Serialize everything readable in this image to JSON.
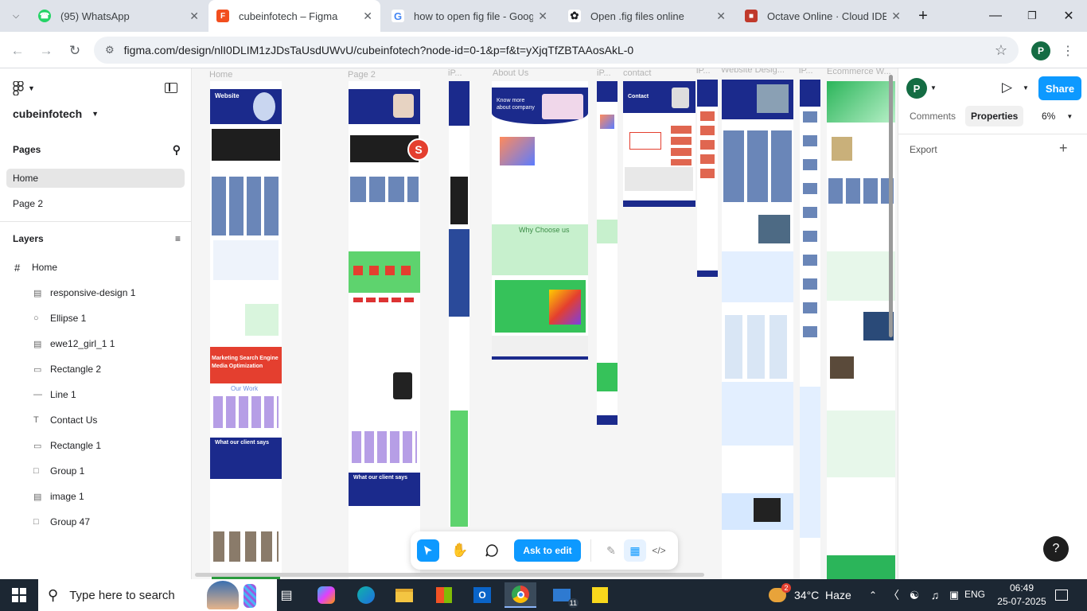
{
  "browser": {
    "tabs": [
      {
        "title": "(95) WhatsApp",
        "icon": "whatsapp-icon",
        "color": "#25d366"
      },
      {
        "title": "cubeinfotech – Figma",
        "icon": "figma-icon",
        "color": "#f24e1e"
      },
      {
        "title": "how to open fig file - Google",
        "icon": "google-icon",
        "color": "#4285f4"
      },
      {
        "title": "Open .fig files online",
        "icon": "openai-icon",
        "color": "#202124"
      },
      {
        "title": "Octave Online · Cloud IDE co",
        "icon": "octave-icon",
        "color": "#c0392b"
      }
    ],
    "url": "figma.com/design/nlI0DLIM1zJDsTaUsdUWvU/cubeinfotech?node-id=0-1&p=f&t=yXjqTfZBTAAosAkL-0",
    "profile_initial": "P"
  },
  "figma": {
    "file_name": "cubeinfotech",
    "pages_title": "Pages",
    "pages": [
      "Home",
      "Page 2"
    ],
    "layers_title": "Layers",
    "layers_root": "Home",
    "layers": [
      {
        "name": "responsive-design 1",
        "icon": "image-icon"
      },
      {
        "name": "Ellipse 1",
        "icon": "ellipse-icon"
      },
      {
        "name": "ewe12_girl_1 1",
        "icon": "image-icon"
      },
      {
        "name": "Rectangle 2",
        "icon": "rectangle-icon"
      },
      {
        "name": "Line 1",
        "icon": "line-icon"
      },
      {
        "name": "Contact Us",
        "icon": "text-icon"
      },
      {
        "name": "Rectangle 1",
        "icon": "rectangle-icon"
      },
      {
        "name": "Group 1",
        "icon": "group-icon"
      },
      {
        "name": "image 1",
        "icon": "image-icon"
      },
      {
        "name": "Group 47",
        "icon": "group-icon"
      }
    ],
    "right": {
      "user_initial": "P",
      "share": "Share",
      "tab_comments": "Comments",
      "tab_properties": "Properties",
      "zoom": "6%",
      "export": "Export"
    },
    "frame_labels": [
      "Home",
      "Page 2",
      "iP...",
      "About Us",
      "iP...",
      "contact",
      "iP...",
      "Website Desig...",
      "iP...",
      "Ecommerce W..."
    ],
    "canvas_text": {
      "why_choose": "Why Choose us",
      "our_work": "Our Work",
      "client_says": "What our client says",
      "seo": "Marketing Search Engine Media Optimization",
      "know_more": "Know more about company",
      "website": "Website",
      "contact": "Contact"
    },
    "cursor_badge": "S",
    "toolbar": {
      "ask": "Ask to edit"
    },
    "help": "?"
  },
  "taskbar": {
    "search_placeholder": "Type here to search",
    "weather": "34°C  Haze",
    "weather_badge": "2",
    "lang": "ENG",
    "time": "06:49",
    "date": "25-07-2025",
    "mail_badge": "11"
  },
  "colors": {
    "accent": "#0d99ff",
    "navy": "#1b2a8c",
    "red": "#e43f2f",
    "green": "#5ed36e"
  }
}
